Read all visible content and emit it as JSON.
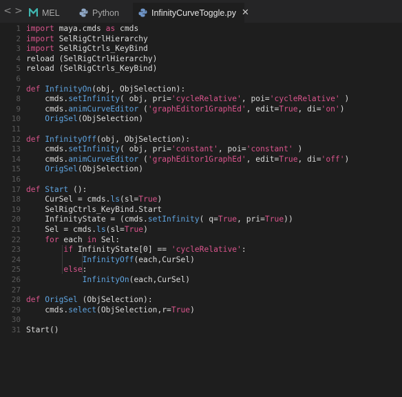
{
  "tabs": [
    {
      "label": "MEL",
      "icon": "maya-mel-icon",
      "active": false
    },
    {
      "label": "Python",
      "icon": "python-icon",
      "active": false
    },
    {
      "label": "InfinityCurveToggle.py",
      "icon": "python-icon",
      "active": true
    }
  ],
  "nav": {
    "back": "<",
    "forward": ">"
  },
  "close_glyph": "✕",
  "colors": {
    "keyword": "#d9548c",
    "function": "#5fa4e0",
    "string": "#d9548c",
    "text": "#dcdcdc",
    "background": "#1e1e1e",
    "tabbar": "#252526"
  },
  "code_lines": [
    [
      [
        "k",
        "import"
      ],
      [
        "t",
        " maya.cmds "
      ],
      [
        "k",
        "as"
      ],
      [
        "t",
        " cmds"
      ]
    ],
    [
      [
        "k",
        "import"
      ],
      [
        "t",
        " SelRigCtrlHierarchy"
      ]
    ],
    [
      [
        "k",
        "import"
      ],
      [
        "t",
        " SelRigCtrls_KeyBind"
      ]
    ],
    [
      [
        "t",
        "reload (SelRigCtrlHierarchy)"
      ]
    ],
    [
      [
        "t",
        "reload (SelRigCtrls_KeyBind)"
      ]
    ],
    [],
    [
      [
        "k",
        "def"
      ],
      [
        "t",
        " "
      ],
      [
        "f",
        "InfinityOn"
      ],
      [
        "t",
        "(obj, ObjSelection):"
      ]
    ],
    [
      [
        "t",
        "    cmds."
      ],
      [
        "f",
        "setInfinity"
      ],
      [
        "t",
        "( obj, pri="
      ],
      [
        "s",
        "'cycleRelative'"
      ],
      [
        "t",
        ", poi="
      ],
      [
        "s",
        "'cycleRelative'"
      ],
      [
        "t",
        " )"
      ]
    ],
    [
      [
        "t",
        "    cmds."
      ],
      [
        "f",
        "animCurveEditor"
      ],
      [
        "t",
        " ("
      ],
      [
        "s",
        "'graphEditor1GraphEd'"
      ],
      [
        "t",
        ", edit="
      ],
      [
        "k",
        "True"
      ],
      [
        "t",
        ", di="
      ],
      [
        "s",
        "'on'"
      ],
      [
        "t",
        ")"
      ]
    ],
    [
      [
        "t",
        "    "
      ],
      [
        "f",
        "OrigSel"
      ],
      [
        "t",
        "(ObjSelection)"
      ]
    ],
    [],
    [
      [
        "k",
        "def"
      ],
      [
        "t",
        " "
      ],
      [
        "f",
        "InfinityOff"
      ],
      [
        "t",
        "(obj, ObjSelection):"
      ]
    ],
    [
      [
        "t",
        "    cmds."
      ],
      [
        "f",
        "setInfinity"
      ],
      [
        "t",
        "( obj, pri="
      ],
      [
        "s",
        "'constant'"
      ],
      [
        "t",
        ", poi="
      ],
      [
        "s",
        "'constant'"
      ],
      [
        "t",
        " )"
      ]
    ],
    [
      [
        "t",
        "    cmds."
      ],
      [
        "f",
        "animCurveEditor"
      ],
      [
        "t",
        " ("
      ],
      [
        "s",
        "'graphEditor1GraphEd'"
      ],
      [
        "t",
        ", edit="
      ],
      [
        "k",
        "True"
      ],
      [
        "t",
        ", di="
      ],
      [
        "s",
        "'off'"
      ],
      [
        "t",
        ")"
      ]
    ],
    [
      [
        "t",
        "    "
      ],
      [
        "f",
        "OrigSel"
      ],
      [
        "t",
        "(ObjSelection)"
      ]
    ],
    [],
    [
      [
        "k",
        "def"
      ],
      [
        "t",
        " "
      ],
      [
        "f",
        "Start"
      ],
      [
        "t",
        " ():"
      ]
    ],
    [
      [
        "t",
        "    CurSel = cmds."
      ],
      [
        "f",
        "ls"
      ],
      [
        "t",
        "(sl="
      ],
      [
        "k",
        "True"
      ],
      [
        "t",
        ")"
      ]
    ],
    [
      [
        "t",
        "    SelRigCtrls_KeyBind.Start"
      ]
    ],
    [
      [
        "t",
        "    InfinityState = (cmds."
      ],
      [
        "f",
        "setInfinity"
      ],
      [
        "t",
        "( q="
      ],
      [
        "k",
        "True"
      ],
      [
        "t",
        ", pri="
      ],
      [
        "k",
        "True"
      ],
      [
        "t",
        "))"
      ]
    ],
    [
      [
        "t",
        "    Sel = cmds."
      ],
      [
        "f",
        "ls"
      ],
      [
        "t",
        "(sl="
      ],
      [
        "k",
        "True"
      ],
      [
        "t",
        ")"
      ]
    ],
    [
      [
        "t",
        "    "
      ],
      [
        "k",
        "for"
      ],
      [
        "t",
        " each "
      ],
      [
        "k",
        "in"
      ],
      [
        "t",
        " Sel:"
      ]
    ],
    [
      [
        "t",
        "        "
      ],
      [
        "k",
        "if"
      ],
      [
        "t",
        " InfinityState[0] == "
      ],
      [
        "s",
        "'cycleRelative'"
      ],
      [
        "t",
        ":"
      ]
    ],
    [
      [
        "t",
        "            "
      ],
      [
        "f",
        "InfinityOff"
      ],
      [
        "t",
        "(each,CurSel)"
      ]
    ],
    [
      [
        "t",
        "        "
      ],
      [
        "k",
        "else"
      ],
      [
        "t",
        ":"
      ]
    ],
    [
      [
        "t",
        "            "
      ],
      [
        "f",
        "InfinityOn"
      ],
      [
        "t",
        "(each,CurSel)"
      ]
    ],
    [],
    [
      [
        "k",
        "def"
      ],
      [
        "t",
        " "
      ],
      [
        "f",
        "OrigSel"
      ],
      [
        "t",
        " (ObjSelection):"
      ]
    ],
    [
      [
        "t",
        "    cmds."
      ],
      [
        "f",
        "select"
      ],
      [
        "t",
        "(ObjSelection,r="
      ],
      [
        "k",
        "True"
      ],
      [
        "t",
        ")"
      ]
    ],
    [],
    [
      [
        "t",
        "Start()"
      ]
    ]
  ]
}
